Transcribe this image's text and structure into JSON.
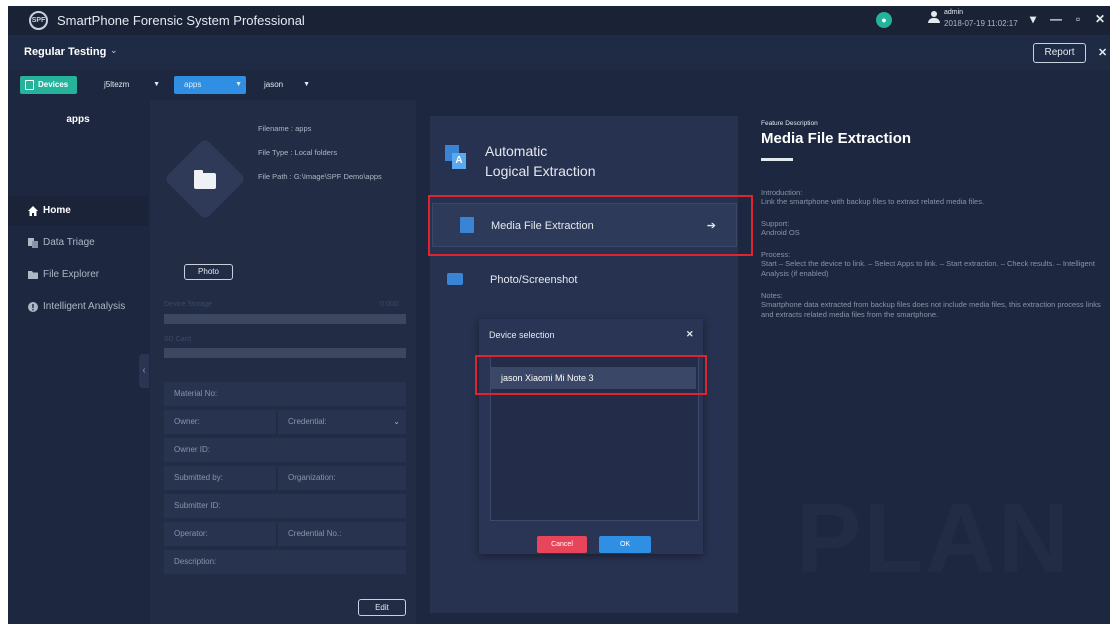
{
  "app": {
    "logo_text": "SPF",
    "title": "SmartPhone Forensic System Professional",
    "user": "admin",
    "datetime": "2018-07-19 11:02:17",
    "window_controls": [
      "▾",
      "—",
      "▫",
      "✕"
    ]
  },
  "subheader": {
    "mode": "Regular Testing",
    "mode_chevron": "⌄",
    "report_label": "Report",
    "close": "✕"
  },
  "toolbar": {
    "devices_label": "Devices",
    "device_select": "j5ltezm",
    "app_select": "apps",
    "case_select": "jason"
  },
  "sidebar": {
    "title": "apps",
    "items": [
      {
        "label": "Home",
        "icon": "home-icon"
      },
      {
        "label": "Data Triage",
        "icon": "data-triage-icon"
      },
      {
        "label": "File Explorer",
        "icon": "folder-icon"
      },
      {
        "label": "Intelligent Analysis",
        "icon": "analysis-icon"
      }
    ]
  },
  "detail": {
    "filename": "Filename : apps",
    "filetype": "File Type : Local folders",
    "filepath": "File Path : G:\\Image\\SPF Demo\\apps",
    "photo_label": "Photo",
    "device_storage": "Device Storage",
    "storage_value": "0.00G",
    "sd_card": "SD Card",
    "fields": {
      "material_no": "Material No:",
      "owner": "Owner:",
      "credential": "Credential:",
      "owner_id": "Owner ID:",
      "submitted_by": "Submitted by:",
      "organization": "Organization:",
      "submitter_id": "Submitter ID:",
      "operator": "Operator:",
      "credential_no": "Credential No.:",
      "description": "Description:"
    },
    "edit_label": "Edit"
  },
  "center": {
    "title_line1": "Automatic",
    "title_line2": "Logical Extraction",
    "options": [
      {
        "label": "Media File Extraction",
        "arrow": "➔"
      },
      {
        "label": "Photo/Screenshot"
      }
    ]
  },
  "dialog": {
    "title": "Device selection",
    "close": "✕",
    "device": "jason Xiaomi Mi Note 3",
    "cancel_label": "Cancel",
    "ok_label": "OK"
  },
  "description": {
    "label": "Feature Description",
    "title": "Media File Extraction",
    "intro_head": "Introduction:",
    "intro_text": "Link the smartphone with backup files to extract related media files.",
    "support_head": "Support:",
    "support_text": "Android OS",
    "process_head": "Process:",
    "process_text": "Start – Select the device to link. – Select Apps to link. – Start extraction. – Check results. – Intelligent Analysis (if enabled)",
    "notes_head": "Notes:",
    "notes_text": "Smartphone data extracted from backup files does not include media files, this extraction process links and extracts related media files from the smartphone.",
    "watermark": "PLAN"
  },
  "colors": {
    "background": "#1d2740",
    "accent_teal": "#26b39b",
    "accent_blue": "#2f8fe3",
    "cancel_red": "#e8455a",
    "highlight_red": "#e0242e"
  }
}
